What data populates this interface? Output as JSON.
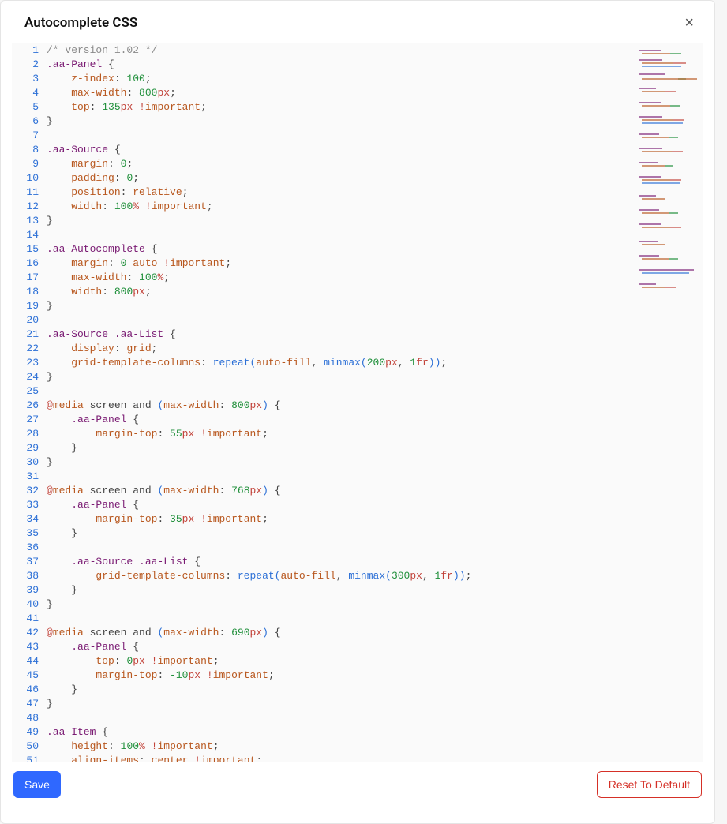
{
  "header": {
    "title": "Autocomplete CSS"
  },
  "buttons": {
    "save": "Save",
    "reset": "Reset To Default",
    "close": "×"
  },
  "editor": {
    "first_line_no": 1,
    "lines": [
      [
        {
          "t": "/* version 1.02 */",
          "c": "comment"
        }
      ],
      [
        {
          "t": ".aa-Panel ",
          "c": "selector"
        },
        {
          "t": "{",
          "c": "punct"
        }
      ],
      [
        {
          "t": "    ",
          "c": "punct"
        },
        {
          "t": "z-index",
          "c": "prop"
        },
        {
          "t": ": ",
          "c": "punct"
        },
        {
          "t": "100",
          "c": "num"
        },
        {
          "t": ";",
          "c": "punct"
        }
      ],
      [
        {
          "t": "    ",
          "c": "punct"
        },
        {
          "t": "max-width",
          "c": "prop"
        },
        {
          "t": ": ",
          "c": "punct"
        },
        {
          "t": "800",
          "c": "num"
        },
        {
          "t": "px",
          "c": "unit"
        },
        {
          "t": ";",
          "c": "punct"
        }
      ],
      [
        {
          "t": "    ",
          "c": "punct"
        },
        {
          "t": "top",
          "c": "prop"
        },
        {
          "t": ": ",
          "c": "punct"
        },
        {
          "t": "135",
          "c": "num"
        },
        {
          "t": "px",
          "c": "unit"
        },
        {
          "t": " ",
          "c": "punct"
        },
        {
          "t": "!",
          "c": "bang"
        },
        {
          "t": "important",
          "c": "ident"
        },
        {
          "t": ";",
          "c": "punct"
        }
      ],
      [
        {
          "t": "}",
          "c": "punct"
        }
      ],
      [
        {
          "t": "",
          "c": "punct"
        }
      ],
      [
        {
          "t": ".aa-Source ",
          "c": "selector"
        },
        {
          "t": "{",
          "c": "punct"
        }
      ],
      [
        {
          "t": "    ",
          "c": "punct"
        },
        {
          "t": "margin",
          "c": "prop"
        },
        {
          "t": ": ",
          "c": "punct"
        },
        {
          "t": "0",
          "c": "num"
        },
        {
          "t": ";",
          "c": "punct"
        }
      ],
      [
        {
          "t": "    ",
          "c": "punct"
        },
        {
          "t": "padding",
          "c": "prop"
        },
        {
          "t": ": ",
          "c": "punct"
        },
        {
          "t": "0",
          "c": "num"
        },
        {
          "t": ";",
          "c": "punct"
        }
      ],
      [
        {
          "t": "    ",
          "c": "punct"
        },
        {
          "t": "position",
          "c": "prop"
        },
        {
          "t": ": ",
          "c": "punct"
        },
        {
          "t": "relative",
          "c": "ident"
        },
        {
          "t": ";",
          "c": "punct"
        }
      ],
      [
        {
          "t": "    ",
          "c": "punct"
        },
        {
          "t": "width",
          "c": "prop"
        },
        {
          "t": ": ",
          "c": "punct"
        },
        {
          "t": "100",
          "c": "num"
        },
        {
          "t": "%",
          "c": "unit"
        },
        {
          "t": " ",
          "c": "punct"
        },
        {
          "t": "!",
          "c": "bang"
        },
        {
          "t": "important",
          "c": "ident"
        },
        {
          "t": ";",
          "c": "punct"
        }
      ],
      [
        {
          "t": "}",
          "c": "punct"
        }
      ],
      [
        {
          "t": "",
          "c": "punct"
        }
      ],
      [
        {
          "t": ".aa-Autocomplete ",
          "c": "selector"
        },
        {
          "t": "{",
          "c": "punct"
        }
      ],
      [
        {
          "t": "    ",
          "c": "punct"
        },
        {
          "t": "margin",
          "c": "prop"
        },
        {
          "t": ": ",
          "c": "punct"
        },
        {
          "t": "0",
          "c": "num"
        },
        {
          "t": " ",
          "c": "punct"
        },
        {
          "t": "auto",
          "c": "ident"
        },
        {
          "t": " ",
          "c": "punct"
        },
        {
          "t": "!",
          "c": "bang"
        },
        {
          "t": "important",
          "c": "ident"
        },
        {
          "t": ";",
          "c": "punct"
        }
      ],
      [
        {
          "t": "    ",
          "c": "punct"
        },
        {
          "t": "max-width",
          "c": "prop"
        },
        {
          "t": ": ",
          "c": "punct"
        },
        {
          "t": "100",
          "c": "num"
        },
        {
          "t": "%",
          "c": "unit"
        },
        {
          "t": ";",
          "c": "punct"
        }
      ],
      [
        {
          "t": "    ",
          "c": "punct"
        },
        {
          "t": "width",
          "c": "prop"
        },
        {
          "t": ": ",
          "c": "punct"
        },
        {
          "t": "800",
          "c": "num"
        },
        {
          "t": "px",
          "c": "unit"
        },
        {
          "t": ";",
          "c": "punct"
        }
      ],
      [
        {
          "t": "}",
          "c": "punct"
        }
      ],
      [
        {
          "t": "",
          "c": "punct"
        }
      ],
      [
        {
          "t": ".aa-Source .aa-List ",
          "c": "selector"
        },
        {
          "t": "{",
          "c": "punct"
        }
      ],
      [
        {
          "t": "    ",
          "c": "punct"
        },
        {
          "t": "display",
          "c": "prop"
        },
        {
          "t": ": ",
          "c": "punct"
        },
        {
          "t": "grid",
          "c": "ident"
        },
        {
          "t": ";",
          "c": "punct"
        }
      ],
      [
        {
          "t": "    ",
          "c": "punct"
        },
        {
          "t": "grid-template-columns",
          "c": "prop"
        },
        {
          "t": ": ",
          "c": "punct"
        },
        {
          "t": "repeat",
          "c": "func"
        },
        {
          "t": "(",
          "c": "paren"
        },
        {
          "t": "auto-fill",
          "c": "ident"
        },
        {
          "t": ", ",
          "c": "punct"
        },
        {
          "t": "minmax",
          "c": "func"
        },
        {
          "t": "(",
          "c": "paren"
        },
        {
          "t": "200",
          "c": "num"
        },
        {
          "t": "px",
          "c": "unit"
        },
        {
          "t": ", ",
          "c": "punct"
        },
        {
          "t": "1",
          "c": "num"
        },
        {
          "t": "fr",
          "c": "unit"
        },
        {
          "t": ")",
          "c": "paren"
        },
        {
          "t": ")",
          "c": "paren"
        },
        {
          "t": ";",
          "c": "punct"
        }
      ],
      [
        {
          "t": "}",
          "c": "punct"
        }
      ],
      [
        {
          "t": "",
          "c": "punct"
        }
      ],
      [
        {
          "t": "@",
          "c": "kw"
        },
        {
          "t": "media",
          "c": "ident"
        },
        {
          "t": " screen and ",
          "c": "punct"
        },
        {
          "t": "(",
          "c": "paren"
        },
        {
          "t": "max-width",
          "c": "prop"
        },
        {
          "t": ": ",
          "c": "punct"
        },
        {
          "t": "800",
          "c": "num"
        },
        {
          "t": "px",
          "c": "unit"
        },
        {
          "t": ")",
          "c": "paren"
        },
        {
          "t": " {",
          "c": "punct"
        }
      ],
      [
        {
          "t": "    ",
          "c": "punct"
        },
        {
          "t": ".aa-Panel ",
          "c": "selector"
        },
        {
          "t": "{",
          "c": "punct"
        }
      ],
      [
        {
          "t": "        ",
          "c": "punct"
        },
        {
          "t": "margin-top",
          "c": "prop"
        },
        {
          "t": ": ",
          "c": "punct"
        },
        {
          "t": "55",
          "c": "num"
        },
        {
          "t": "px",
          "c": "unit"
        },
        {
          "t": " ",
          "c": "punct"
        },
        {
          "t": "!",
          "c": "bang"
        },
        {
          "t": "important",
          "c": "ident"
        },
        {
          "t": ";",
          "c": "punct"
        }
      ],
      [
        {
          "t": "    }",
          "c": "punct"
        }
      ],
      [
        {
          "t": "}",
          "c": "punct"
        }
      ],
      [
        {
          "t": "",
          "c": "punct"
        }
      ],
      [
        {
          "t": "@",
          "c": "kw"
        },
        {
          "t": "media",
          "c": "ident"
        },
        {
          "t": " screen and ",
          "c": "punct"
        },
        {
          "t": "(",
          "c": "paren"
        },
        {
          "t": "max-width",
          "c": "prop"
        },
        {
          "t": ": ",
          "c": "punct"
        },
        {
          "t": "768",
          "c": "num"
        },
        {
          "t": "px",
          "c": "unit"
        },
        {
          "t": ")",
          "c": "paren"
        },
        {
          "t": " {",
          "c": "punct"
        }
      ],
      [
        {
          "t": "    ",
          "c": "punct"
        },
        {
          "t": ".aa-Panel ",
          "c": "selector"
        },
        {
          "t": "{",
          "c": "punct"
        }
      ],
      [
        {
          "t": "        ",
          "c": "punct"
        },
        {
          "t": "margin-top",
          "c": "prop"
        },
        {
          "t": ": ",
          "c": "punct"
        },
        {
          "t": "35",
          "c": "num"
        },
        {
          "t": "px",
          "c": "unit"
        },
        {
          "t": " ",
          "c": "punct"
        },
        {
          "t": "!",
          "c": "bang"
        },
        {
          "t": "important",
          "c": "ident"
        },
        {
          "t": ";",
          "c": "punct"
        }
      ],
      [
        {
          "t": "    }",
          "c": "punct"
        }
      ],
      [
        {
          "t": "",
          "c": "punct"
        }
      ],
      [
        {
          "t": "    ",
          "c": "punct"
        },
        {
          "t": ".aa-Source .aa-List ",
          "c": "selector"
        },
        {
          "t": "{",
          "c": "punct"
        }
      ],
      [
        {
          "t": "        ",
          "c": "punct"
        },
        {
          "t": "grid-template-columns",
          "c": "prop"
        },
        {
          "t": ": ",
          "c": "punct"
        },
        {
          "t": "repeat",
          "c": "func"
        },
        {
          "t": "(",
          "c": "paren"
        },
        {
          "t": "auto-fill",
          "c": "ident"
        },
        {
          "t": ", ",
          "c": "punct"
        },
        {
          "t": "minmax",
          "c": "func"
        },
        {
          "t": "(",
          "c": "paren"
        },
        {
          "t": "300",
          "c": "num"
        },
        {
          "t": "px",
          "c": "unit"
        },
        {
          "t": ", ",
          "c": "punct"
        },
        {
          "t": "1",
          "c": "num"
        },
        {
          "t": "fr",
          "c": "unit"
        },
        {
          "t": ")",
          "c": "paren"
        },
        {
          "t": ")",
          "c": "paren"
        },
        {
          "t": ";",
          "c": "punct"
        }
      ],
      [
        {
          "t": "    }",
          "c": "punct"
        }
      ],
      [
        {
          "t": "}",
          "c": "punct"
        }
      ],
      [
        {
          "t": "",
          "c": "punct"
        }
      ],
      [
        {
          "t": "@",
          "c": "kw"
        },
        {
          "t": "media",
          "c": "ident"
        },
        {
          "t": " screen and ",
          "c": "punct"
        },
        {
          "t": "(",
          "c": "paren"
        },
        {
          "t": "max-width",
          "c": "prop"
        },
        {
          "t": ": ",
          "c": "punct"
        },
        {
          "t": "690",
          "c": "num"
        },
        {
          "t": "px",
          "c": "unit"
        },
        {
          "t": ")",
          "c": "paren"
        },
        {
          "t": " {",
          "c": "punct"
        }
      ],
      [
        {
          "t": "    ",
          "c": "punct"
        },
        {
          "t": ".aa-Panel ",
          "c": "selector"
        },
        {
          "t": "{",
          "c": "punct"
        }
      ],
      [
        {
          "t": "        ",
          "c": "punct"
        },
        {
          "t": "top",
          "c": "prop"
        },
        {
          "t": ": ",
          "c": "punct"
        },
        {
          "t": "0",
          "c": "num"
        },
        {
          "t": "px",
          "c": "unit"
        },
        {
          "t": " ",
          "c": "punct"
        },
        {
          "t": "!",
          "c": "bang"
        },
        {
          "t": "important",
          "c": "ident"
        },
        {
          "t": ";",
          "c": "punct"
        }
      ],
      [
        {
          "t": "        ",
          "c": "punct"
        },
        {
          "t": "margin-top",
          "c": "prop"
        },
        {
          "t": ": ",
          "c": "punct"
        },
        {
          "t": "-10",
          "c": "num"
        },
        {
          "t": "px",
          "c": "unit"
        },
        {
          "t": " ",
          "c": "punct"
        },
        {
          "t": "!",
          "c": "bang"
        },
        {
          "t": "important",
          "c": "ident"
        },
        {
          "t": ";",
          "c": "punct"
        }
      ],
      [
        {
          "t": "    }",
          "c": "punct"
        }
      ],
      [
        {
          "t": "}",
          "c": "punct"
        }
      ],
      [
        {
          "t": "",
          "c": "punct"
        }
      ],
      [
        {
          "t": ".aa-Item ",
          "c": "selector"
        },
        {
          "t": "{",
          "c": "punct"
        }
      ],
      [
        {
          "t": "    ",
          "c": "punct"
        },
        {
          "t": "height",
          "c": "prop"
        },
        {
          "t": ": ",
          "c": "punct"
        },
        {
          "t": "100",
          "c": "num"
        },
        {
          "t": "%",
          "c": "unit"
        },
        {
          "t": " ",
          "c": "punct"
        },
        {
          "t": "!",
          "c": "bang"
        },
        {
          "t": "important",
          "c": "ident"
        },
        {
          "t": ";",
          "c": "punct"
        }
      ],
      [
        {
          "t": "    ",
          "c": "punct"
        },
        {
          "t": "align-items",
          "c": "prop"
        },
        {
          "t": ": ",
          "c": "punct"
        },
        {
          "t": "center",
          "c": "ident"
        },
        {
          "t": " ",
          "c": "punct"
        },
        {
          "t": "!",
          "c": "bang"
        },
        {
          "t": "important",
          "c": "ident"
        },
        {
          "t": ";",
          "c": "punct"
        }
      ]
    ]
  }
}
